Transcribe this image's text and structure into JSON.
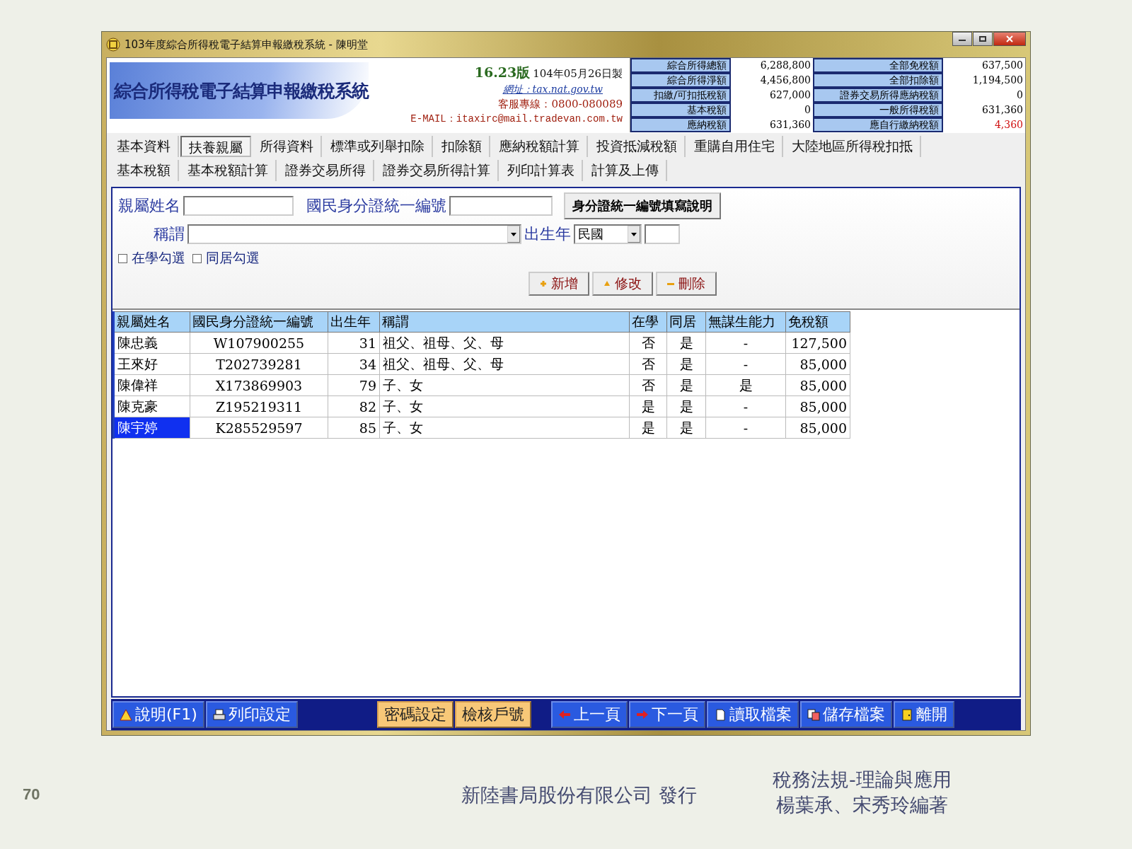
{
  "window": {
    "title": "103年度綜合所得稅電子結算申報繳稅系統 - 陳明堂"
  },
  "header": {
    "title": "綜合所得稅電子結算申報繳稅系統",
    "version": "16.23版",
    "date": "104年05月26日製",
    "website": "網址：tax.nat.gov.tw",
    "hotline": "客服專線：0800-080089",
    "email": "E-MAIL：itaxirc@mail.tradevan.com.tw"
  },
  "summary": [
    {
      "label": "綜合所得總額",
      "value": "6,288,800",
      "alert": false
    },
    {
      "label": "全部免稅額",
      "value": "637,500",
      "alert": false
    },
    {
      "label": "綜合所得淨額",
      "value": "4,456,800",
      "alert": false
    },
    {
      "label": "全部扣除額",
      "value": "1,194,500",
      "alert": false
    },
    {
      "label": "扣繳/可扣抵稅額",
      "value": "627,000",
      "alert": false
    },
    {
      "label": "證券交易所得應納稅額",
      "value": "0",
      "alert": false
    },
    {
      "label": "基本稅額",
      "value": "0",
      "alert": false
    },
    {
      "label": "一般所得稅額",
      "value": "631,360",
      "alert": false
    },
    {
      "label": "應納稅額",
      "value": "631,360",
      "alert": false
    },
    {
      "label": "應自行繳納稅額",
      "value": "4,360",
      "alert": true
    }
  ],
  "tabs": [
    [
      {
        "label": "基本資料",
        "selected": false
      },
      {
        "label": "扶養親屬",
        "selected": true
      },
      {
        "label": "所得資料",
        "selected": false
      },
      {
        "label": "標準或列舉扣除",
        "selected": false
      },
      {
        "label": "扣除額",
        "selected": false
      },
      {
        "label": "應納稅額計算",
        "selected": false
      },
      {
        "label": "投資抵減稅額",
        "selected": false
      },
      {
        "label": "重購自用住宅",
        "selected": false
      },
      {
        "label": "大陸地區所得稅扣抵",
        "selected": false
      }
    ],
    [
      {
        "label": "基本稅額",
        "selected": false
      },
      {
        "label": "基本稅額計算",
        "selected": false
      },
      {
        "label": "證券交易所得",
        "selected": false
      },
      {
        "label": "證券交易所得計算",
        "selected": false
      },
      {
        "label": "列印計算表",
        "selected": false
      },
      {
        "label": "計算及上傳",
        "selected": false
      }
    ]
  ],
  "form": {
    "name_label": "親屬姓名",
    "id_label": "國民身分證統一編號",
    "id_help_button": "身分證統一編號填寫說明",
    "title_label": "稱謂",
    "birth_label": "出生年",
    "era_value": "民國",
    "checkboxes": [
      {
        "label": "在學勾選",
        "checked": false
      },
      {
        "label": "同居勾選",
        "checked": false
      }
    ],
    "actions": [
      {
        "label": "新增",
        "kind": "add"
      },
      {
        "label": "修改",
        "kind": "edit"
      },
      {
        "label": "刪除",
        "kind": "delete"
      }
    ]
  },
  "table": {
    "columns": [
      "親屬姓名",
      "國民身分證統一編號",
      "出生年",
      "稱謂",
      "在學",
      "同居",
      "無謀生能力",
      "免稅額"
    ],
    "rows": [
      {
        "cells": [
          "陳忠義",
          "W107900255",
          "31",
          "祖父、祖母、父、母",
          "否",
          "是",
          "-",
          "127,500"
        ],
        "selected": false
      },
      {
        "cells": [
          "王來好",
          "T202739281",
          "34",
          "祖父、祖母、父、母",
          "否",
          "是",
          "-",
          "85,000"
        ],
        "selected": false
      },
      {
        "cells": [
          "陳偉祥",
          "X173869903",
          "79",
          "子、女",
          "否",
          "是",
          "是",
          "85,000"
        ],
        "selected": false
      },
      {
        "cells": [
          "陳克豪",
          "Z195219311",
          "82",
          "子、女",
          "是",
          "是",
          "-",
          "85,000"
        ],
        "selected": false
      },
      {
        "cells": [
          "陳宇婷",
          "K285529597",
          "85",
          "子、女",
          "是",
          "是",
          "-",
          "85,000"
        ],
        "selected": true
      }
    ]
  },
  "toolbar": [
    {
      "label": "說明(F1)",
      "kind": "help"
    },
    {
      "label": "列印設定",
      "kind": "print"
    },
    {
      "kind": "gap"
    },
    {
      "label": "密碼設定",
      "kind": "accent"
    },
    {
      "label": "檢核戶號",
      "kind": "accent"
    },
    {
      "kind": "gap"
    },
    {
      "label": "上一頁",
      "kind": "prev"
    },
    {
      "label": "下一頁",
      "kind": "next"
    },
    {
      "label": "讀取檔案",
      "kind": "open"
    },
    {
      "label": "儲存檔案",
      "kind": "save"
    },
    {
      "label": "離開",
      "kind": "exit"
    }
  ],
  "footer": {
    "page_number": "70",
    "publisher": "新陸書局股份有限公司 發行",
    "book_title": "稅務法規-理論與應用",
    "authors": "楊葉承、宋秀玲編著"
  }
}
